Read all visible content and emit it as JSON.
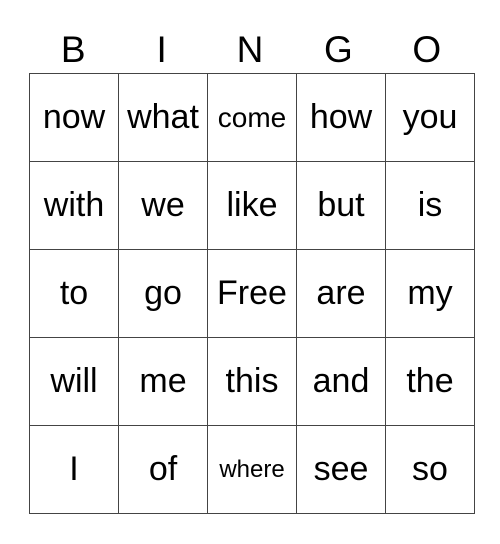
{
  "header": [
    "B",
    "I",
    "N",
    "G",
    "O"
  ],
  "rows": [
    [
      "now",
      "what",
      "come",
      "how",
      "you"
    ],
    [
      "with",
      "we",
      "like",
      "but",
      "is"
    ],
    [
      "to",
      "go",
      "Free",
      "are",
      "my"
    ],
    [
      "will",
      "me",
      "this",
      "and",
      "the"
    ],
    [
      "I",
      "of",
      "where",
      "see",
      "so"
    ]
  ]
}
